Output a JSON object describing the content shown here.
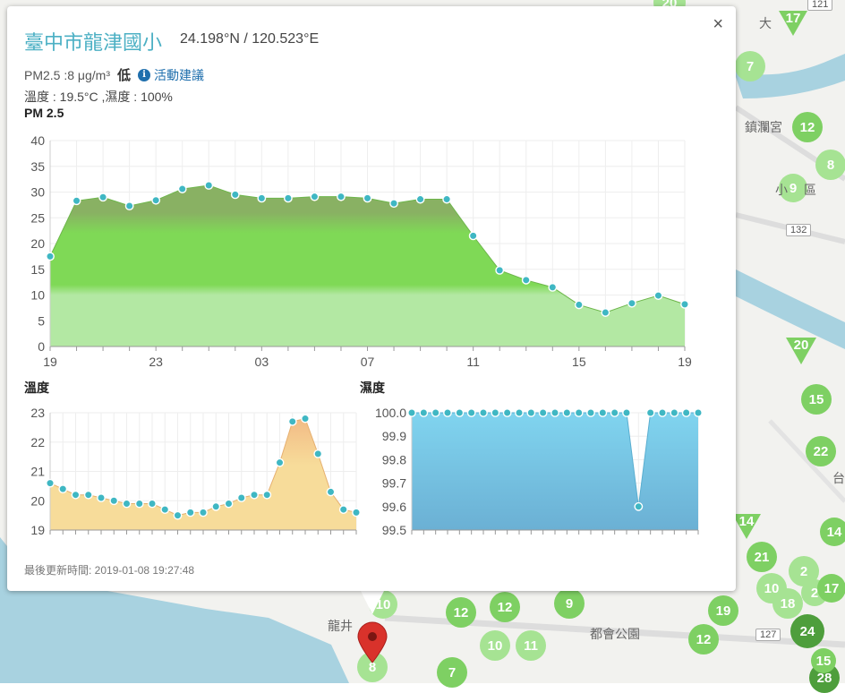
{
  "popup": {
    "site_name": "臺中市龍津國小",
    "coords": "24.198°N / 120.523°E",
    "pm_text": "PM2.5 :8 μg/m³",
    "level": "低",
    "info_glyph": "i",
    "advice_link": "活動建議",
    "temp_humidity": "溫度 : 19.5°C ,濕度 : 100%",
    "close_glyph": "×",
    "updated": "最後更新時間: 2019-01-08 19:27:48",
    "icons": {
      "close": "close-icon",
      "info": "info-icon",
      "location": "location-pin-icon"
    }
  },
  "map": {
    "colors": {
      "sea": "#a8d2e0",
      "land": "#f2f2ef",
      "marker_green": "#7ed063",
      "marker_light": "#a6e393",
      "marker_dark": "#4e9e3c"
    },
    "markers": [
      {
        "label": "20",
        "type": "light"
      },
      {
        "label": "17",
        "type": "tri"
      },
      {
        "label": "7",
        "type": "light"
      },
      {
        "label": "12",
        "type": "green"
      },
      {
        "label": "8",
        "type": "light"
      },
      {
        "label": "9",
        "type": "light"
      },
      {
        "label": "20",
        "type": "tri"
      },
      {
        "label": "15",
        "type": "green"
      },
      {
        "label": "22",
        "type": "green"
      },
      {
        "label": "14",
        "type": "tri"
      },
      {
        "label": "14",
        "type": "green"
      },
      {
        "label": "21",
        "type": "green"
      },
      {
        "label": "2",
        "type": "light"
      },
      {
        "label": "10",
        "type": "light"
      },
      {
        "label": "18",
        "type": "light"
      },
      {
        "label": "2",
        "type": "light"
      },
      {
        "label": "17",
        "type": "green"
      },
      {
        "label": "24",
        "type": "dark"
      },
      {
        "label": "19",
        "type": "green"
      },
      {
        "label": "12",
        "type": "green"
      },
      {
        "label": "9",
        "type": "green"
      },
      {
        "label": "12",
        "type": "green"
      },
      {
        "label": "12",
        "type": "green"
      },
      {
        "label": "10",
        "type": "light"
      },
      {
        "label": "11",
        "type": "light"
      },
      {
        "label": "10",
        "type": "light"
      },
      {
        "label": "7",
        "type": "green"
      },
      {
        "label": "8",
        "type": "light"
      },
      {
        "label": "28",
        "type": "dark"
      },
      {
        "label": "15",
        "type": "green"
      }
    ],
    "labels": [
      "大",
      "鎮瀾宮",
      "小",
      "區",
      "台",
      "龍井",
      "都會公園"
    ],
    "road_signs": [
      "121",
      "132",
      "127"
    ]
  },
  "chart_data": [
    {
      "type": "area",
      "title": "PM 2.5",
      "ylim": [
        0,
        40
      ],
      "y_ticks": [
        0,
        5,
        10,
        15,
        20,
        25,
        30,
        35,
        40
      ],
      "x_tick_labels": [
        "19",
        "23",
        "03",
        "07",
        "11",
        "15",
        "19"
      ],
      "x_tick_index": [
        0,
        4,
        8,
        12,
        16,
        20,
        24
      ],
      "values": [
        17.5,
        28.3,
        29.0,
        27.3,
        28.4,
        30.6,
        31.3,
        29.5,
        28.8,
        28.8,
        29.1,
        29.1,
        28.8,
        27.8,
        28.6,
        28.6,
        21.5,
        14.8,
        12.9,
        11.5,
        8.1,
        6.6,
        8.4,
        9.9,
        8.2
      ],
      "colors": {
        "top": "#89b163",
        "mid": "#7fd956",
        "low": "#b3e8a3",
        "dot": "#3fb7c3"
      }
    },
    {
      "type": "area",
      "title": "溫度",
      "ylim": [
        19,
        23
      ],
      "y_ticks": [
        19,
        20,
        21,
        22,
        23
      ],
      "values": [
        20.6,
        20.4,
        20.2,
        20.2,
        20.1,
        20.0,
        19.9,
        19.9,
        19.9,
        19.7,
        19.5,
        19.6,
        19.6,
        19.8,
        19.9,
        20.1,
        20.2,
        20.2,
        21.3,
        22.7,
        22.8,
        21.6,
        20.3,
        19.7,
        19.6
      ],
      "colors": {
        "top": "#f1b783",
        "low": "#f7dc9a",
        "dot": "#3fb7c3"
      }
    },
    {
      "type": "area",
      "title": "濕度",
      "ylim": [
        99.5,
        100.0
      ],
      "y_ticks": [
        99.5,
        99.6,
        99.7,
        99.8,
        99.9,
        100.0
      ],
      "values": [
        100,
        100,
        100,
        100,
        100,
        100,
        100,
        100,
        100,
        100,
        100,
        100,
        100,
        100,
        100,
        100,
        100,
        100,
        100,
        99.6,
        100,
        100,
        100,
        100,
        100
      ],
      "colors": {
        "top": "#80d4ef",
        "low": "#6bb0d4",
        "dot": "#3fb7c3"
      }
    }
  ]
}
